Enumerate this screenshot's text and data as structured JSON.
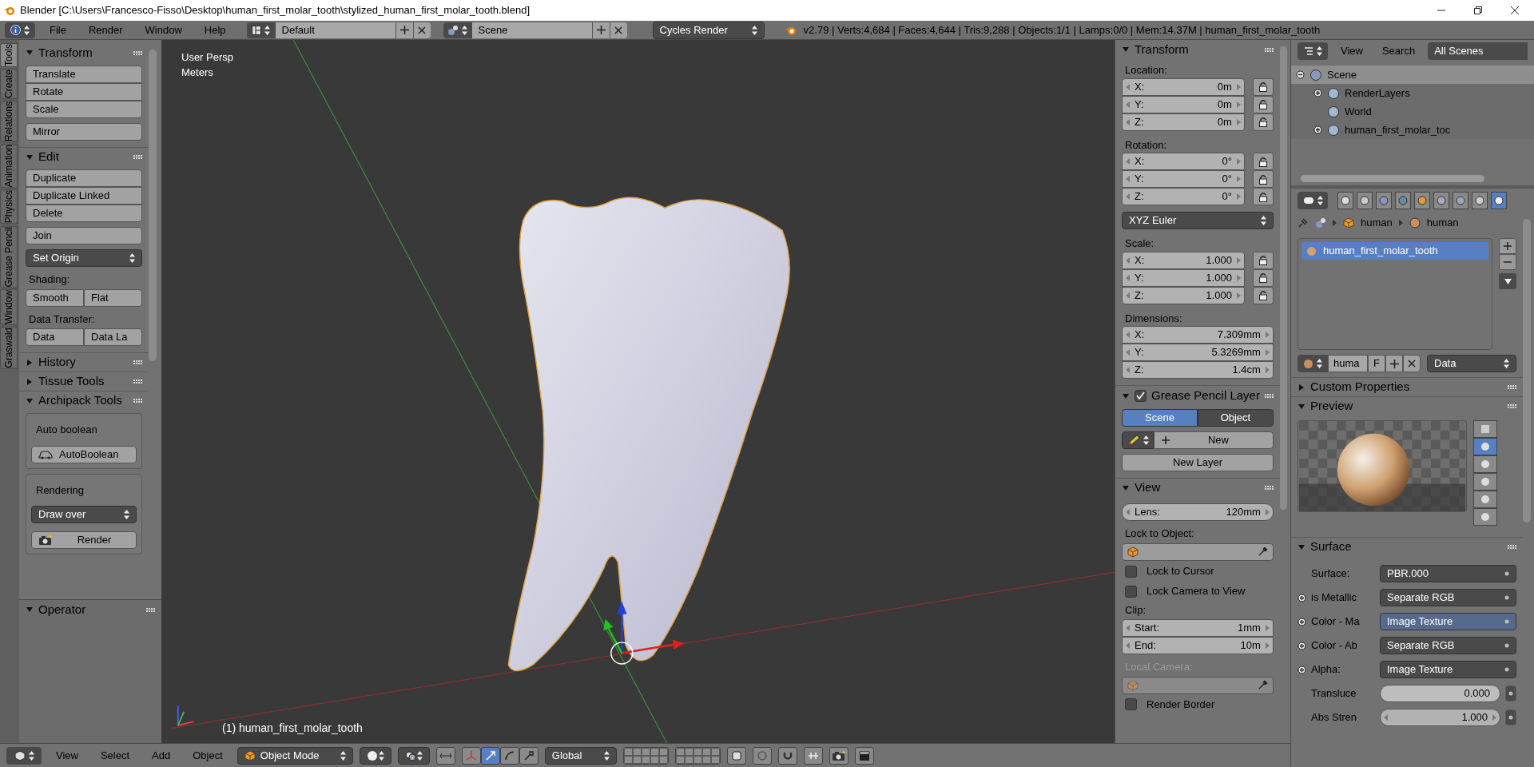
{
  "window": {
    "title": "Blender [C:\\Users\\Francesco-Fisso\\Desktop\\human_first_molar_tooth\\stylized_human_first_molar_tooth.blend]"
  },
  "info_header": {
    "menus": [
      "File",
      "Render",
      "Window",
      "Help"
    ],
    "screen_layout": "Default",
    "scene": "Scene",
    "render_engine": "Cycles Render",
    "stats": "v2.79 | Verts:4,684 | Faces:4,644 | Tris:9,288 | Objects:1/1 | Lamps:0/0 | Mem:14.37M | human_first_molar_tooth"
  },
  "tool_tabs": [
    {
      "label": "Tools",
      "selected": true
    },
    {
      "label": "Create",
      "selected": false
    },
    {
      "label": "Relations",
      "selected": false
    },
    {
      "label": "Animation",
      "selected": false
    },
    {
      "label": "Physics",
      "selected": false
    },
    {
      "label": "Grease Pencil",
      "selected": false
    },
    {
      "label": "Window",
      "selected": false
    },
    {
      "label": "Graswald",
      "selected": false
    }
  ],
  "tool_panels": [
    {
      "title": "Transform",
      "expanded": true,
      "rows": [
        {
          "kind": "column",
          "items": [
            "Translate",
            "Rotate",
            "Scale"
          ]
        },
        {
          "kind": "column",
          "items": [
            "Mirror"
          ]
        }
      ]
    },
    {
      "title": "Edit",
      "expanded": true,
      "rows": [
        {
          "kind": "column",
          "items": [
            "Duplicate",
            "Duplicate Linked",
            "Delete"
          ]
        },
        {
          "kind": "column",
          "items": [
            "Join"
          ]
        },
        {
          "kind": "dropdown",
          "value": "Set Origin"
        },
        {
          "kind": "label",
          "text": "Shading:"
        },
        {
          "kind": "row",
          "items": [
            "Smooth",
            "Flat"
          ]
        },
        {
          "kind": "label",
          "text": "Data Transfer:"
        },
        {
          "kind": "row",
          "items": [
            "Data",
            "Data La"
          ]
        }
      ]
    },
    {
      "title": "History",
      "expanded": false
    },
    {
      "title": "Tissue Tools",
      "expanded": false
    },
    {
      "title": "Archipack Tools",
      "expanded": true,
      "rows": [
        {
          "kind": "box",
          "label": "Auto boolean",
          "rows": [
            {
              "kind": "icon_button",
              "text": "AutoBoolean"
            }
          ]
        },
        {
          "kind": "box",
          "label": "Rendering",
          "rows": [
            {
              "kind": "dropdown",
              "value": "Draw over"
            },
            {
              "kind": "icon_button",
              "text": "Render"
            }
          ]
        }
      ]
    }
  ],
  "operator_panel": {
    "title": "Operator",
    "expanded": true
  },
  "viewport": {
    "view_name": "User Persp",
    "units": "Meters",
    "object_label": "(1) human_first_molar_tooth"
  },
  "view_header": {
    "menus": [
      "View",
      "Select",
      "Add",
      "Object"
    ],
    "mode": "Object Mode",
    "orientation": "Global"
  },
  "n_panel": {
    "transform": {
      "title": "Transform",
      "expanded": true,
      "groups": [
        {
          "kind": "vector",
          "label": "Location:",
          "fields": [
            {
              "axis": "X:",
              "value": "0m",
              "locked": false
            },
            {
              "axis": "Y:",
              "value": "0m",
              "locked": false
            },
            {
              "axis": "Z:",
              "value": "0m",
              "locked": false
            }
          ]
        },
        {
          "kind": "vector",
          "label": "Rotation:",
          "fields": [
            {
              "axis": "X:",
              "value": "0°",
              "locked": false
            },
            {
              "axis": "Y:",
              "value": "0°",
              "locked": false
            },
            {
              "axis": "Z:",
              "value": "0°",
              "locked": false
            }
          ]
        },
        {
          "kind": "dropdown",
          "value": "XYZ Euler"
        },
        {
          "kind": "vector",
          "label": "Scale:",
          "fields": [
            {
              "axis": "X:",
              "value": "1.000",
              "locked": false
            },
            {
              "axis": "Y:",
              "value": "1.000",
              "locked": false
            },
            {
              "axis": "Z:",
              "value": "1.000",
              "locked": false
            }
          ]
        },
        {
          "kind": "vector",
          "label": "Dimensions:",
          "fields": [
            {
              "axis": "X:",
              "value": "7.309mm"
            },
            {
              "axis": "Y:",
              "value": "5.3269mm"
            },
            {
              "axis": "Z:",
              "value": "1.4cm"
            }
          ]
        }
      ]
    },
    "grease_pencil": {
      "title": "Grease Pencil Layer",
      "expanded": true,
      "enabled": true,
      "sources": [
        {
          "label": "Scene",
          "selected": true
        },
        {
          "label": "Object",
          "selected": false
        }
      ],
      "new_button": "New",
      "new_layer_button": "New Layer"
    },
    "view": {
      "title": "View",
      "expanded": true,
      "lens": {
        "label": "Lens:",
        "value": "120mm"
      },
      "lock_to_object_label": "Lock to Object:",
      "checks": [
        {
          "label": "Lock to Cursor",
          "checked": false
        },
        {
          "label": "Lock Camera to View",
          "checked": false
        }
      ],
      "clip_label": "Clip:",
      "clip": [
        {
          "label": "Start:",
          "value": "1mm"
        },
        {
          "label": "End:",
          "value": "10m"
        }
      ],
      "local_camera_label": "Local Camera:",
      "local_camera_disabled": true,
      "render_border": {
        "label": "Render Border",
        "checked": false
      }
    }
  },
  "outliner": {
    "menus": [
      "View",
      "Search"
    ],
    "filter": "All Scenes",
    "tree": [
      {
        "label": "Scene",
        "expanded": true,
        "selected": true,
        "children": [
          {
            "label": "RenderLayers",
            "expanded": false,
            "selected": false
          },
          {
            "label": "World",
            "selected": false
          },
          {
            "label": "human_first_molar_toc",
            "expanded": false,
            "selected": false
          }
        ]
      }
    ]
  },
  "properties": {
    "context_tabs": [
      {
        "selected": false
      },
      {
        "selected": false
      },
      {
        "selected": false
      },
      {
        "selected": false
      },
      {
        "selected": false
      },
      {
        "selected": false
      },
      {
        "selected": false
      },
      {
        "selected": false
      },
      {
        "selected": true
      }
    ],
    "breadcrumb": [
      "human",
      "human"
    ],
    "slots": [
      {
        "name": "human_first_molar_tooth",
        "selected": true
      }
    ],
    "material_name": "huma",
    "fake_user": "F",
    "link": "Data",
    "custom_properties": {
      "title": "Custom Properties",
      "expanded": false
    },
    "preview": {
      "title": "Preview",
      "expanded": true,
      "shapes": [
        {
          "selected": false
        },
        {
          "selected": true
        },
        {
          "selected": false
        },
        {
          "selected": false
        },
        {
          "selected": false
        },
        {
          "selected": false
        }
      ]
    },
    "surface": {
      "title": "Surface",
      "expanded": true,
      "rows": [
        {
          "kind": "node",
          "label": "Surface:",
          "value": "PBR.000",
          "expandable": false,
          "highlighted": false
        },
        {
          "kind": "node",
          "label": "is Metallic",
          "value": "Separate RGB",
          "expandable": true,
          "highlighted": false
        },
        {
          "kind": "node",
          "label": "Color - Ma",
          "value": "Image Texture",
          "expandable": true,
          "highlighted": true
        },
        {
          "kind": "node",
          "label": "Color - Ab",
          "value": "Separate RGB",
          "expandable": true,
          "highlighted": false
        },
        {
          "kind": "node",
          "label": "Alpha:",
          "value": "Image Texture",
          "expandable": true,
          "highlighted": false
        },
        {
          "kind": "slider",
          "label": "Transluce",
          "value": "0.000",
          "level": 0,
          "expandable": false
        },
        {
          "kind": "number",
          "label": "Abs Stren",
          "value": "1.000",
          "expandable": false
        }
      ]
    }
  }
}
